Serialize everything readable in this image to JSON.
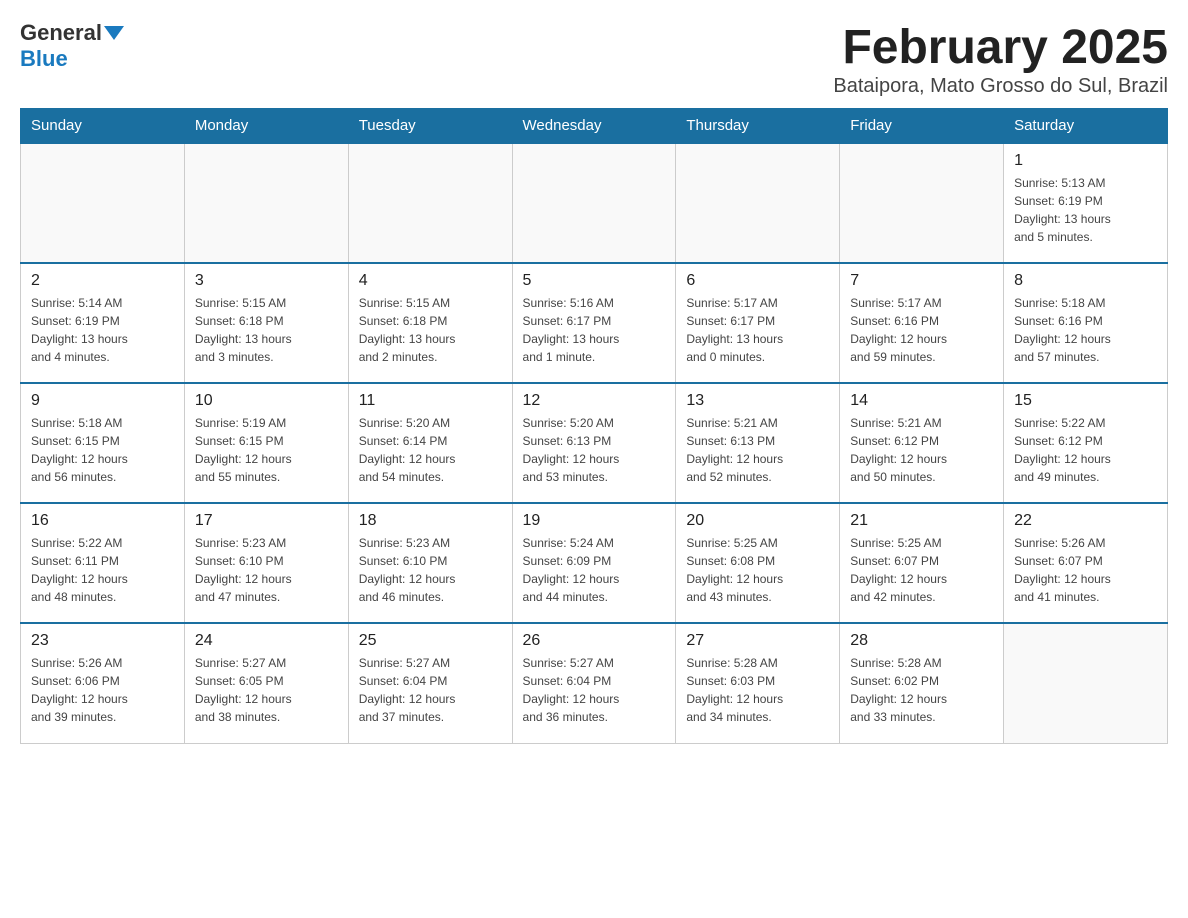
{
  "header": {
    "logo_general": "General",
    "logo_blue": "Blue",
    "month_title": "February 2025",
    "location": "Bataipora, Mato Grosso do Sul, Brazil"
  },
  "days_of_week": [
    "Sunday",
    "Monday",
    "Tuesday",
    "Wednesday",
    "Thursday",
    "Friday",
    "Saturday"
  ],
  "weeks": [
    {
      "days": [
        {
          "number": "",
          "info": ""
        },
        {
          "number": "",
          "info": ""
        },
        {
          "number": "",
          "info": ""
        },
        {
          "number": "",
          "info": ""
        },
        {
          "number": "",
          "info": ""
        },
        {
          "number": "",
          "info": ""
        },
        {
          "number": "1",
          "info": "Sunrise: 5:13 AM\nSunset: 6:19 PM\nDaylight: 13 hours\nand 5 minutes."
        }
      ]
    },
    {
      "days": [
        {
          "number": "2",
          "info": "Sunrise: 5:14 AM\nSunset: 6:19 PM\nDaylight: 13 hours\nand 4 minutes."
        },
        {
          "number": "3",
          "info": "Sunrise: 5:15 AM\nSunset: 6:18 PM\nDaylight: 13 hours\nand 3 minutes."
        },
        {
          "number": "4",
          "info": "Sunrise: 5:15 AM\nSunset: 6:18 PM\nDaylight: 13 hours\nand 2 minutes."
        },
        {
          "number": "5",
          "info": "Sunrise: 5:16 AM\nSunset: 6:17 PM\nDaylight: 13 hours\nand 1 minute."
        },
        {
          "number": "6",
          "info": "Sunrise: 5:17 AM\nSunset: 6:17 PM\nDaylight: 13 hours\nand 0 minutes."
        },
        {
          "number": "7",
          "info": "Sunrise: 5:17 AM\nSunset: 6:16 PM\nDaylight: 12 hours\nand 59 minutes."
        },
        {
          "number": "8",
          "info": "Sunrise: 5:18 AM\nSunset: 6:16 PM\nDaylight: 12 hours\nand 57 minutes."
        }
      ]
    },
    {
      "days": [
        {
          "number": "9",
          "info": "Sunrise: 5:18 AM\nSunset: 6:15 PM\nDaylight: 12 hours\nand 56 minutes."
        },
        {
          "number": "10",
          "info": "Sunrise: 5:19 AM\nSunset: 6:15 PM\nDaylight: 12 hours\nand 55 minutes."
        },
        {
          "number": "11",
          "info": "Sunrise: 5:20 AM\nSunset: 6:14 PM\nDaylight: 12 hours\nand 54 minutes."
        },
        {
          "number": "12",
          "info": "Sunrise: 5:20 AM\nSunset: 6:13 PM\nDaylight: 12 hours\nand 53 minutes."
        },
        {
          "number": "13",
          "info": "Sunrise: 5:21 AM\nSunset: 6:13 PM\nDaylight: 12 hours\nand 52 minutes."
        },
        {
          "number": "14",
          "info": "Sunrise: 5:21 AM\nSunset: 6:12 PM\nDaylight: 12 hours\nand 50 minutes."
        },
        {
          "number": "15",
          "info": "Sunrise: 5:22 AM\nSunset: 6:12 PM\nDaylight: 12 hours\nand 49 minutes."
        }
      ]
    },
    {
      "days": [
        {
          "number": "16",
          "info": "Sunrise: 5:22 AM\nSunset: 6:11 PM\nDaylight: 12 hours\nand 48 minutes."
        },
        {
          "number": "17",
          "info": "Sunrise: 5:23 AM\nSunset: 6:10 PM\nDaylight: 12 hours\nand 47 minutes."
        },
        {
          "number": "18",
          "info": "Sunrise: 5:23 AM\nSunset: 6:10 PM\nDaylight: 12 hours\nand 46 minutes."
        },
        {
          "number": "19",
          "info": "Sunrise: 5:24 AM\nSunset: 6:09 PM\nDaylight: 12 hours\nand 44 minutes."
        },
        {
          "number": "20",
          "info": "Sunrise: 5:25 AM\nSunset: 6:08 PM\nDaylight: 12 hours\nand 43 minutes."
        },
        {
          "number": "21",
          "info": "Sunrise: 5:25 AM\nSunset: 6:07 PM\nDaylight: 12 hours\nand 42 minutes."
        },
        {
          "number": "22",
          "info": "Sunrise: 5:26 AM\nSunset: 6:07 PM\nDaylight: 12 hours\nand 41 minutes."
        }
      ]
    },
    {
      "days": [
        {
          "number": "23",
          "info": "Sunrise: 5:26 AM\nSunset: 6:06 PM\nDaylight: 12 hours\nand 39 minutes."
        },
        {
          "number": "24",
          "info": "Sunrise: 5:27 AM\nSunset: 6:05 PM\nDaylight: 12 hours\nand 38 minutes."
        },
        {
          "number": "25",
          "info": "Sunrise: 5:27 AM\nSunset: 6:04 PM\nDaylight: 12 hours\nand 37 minutes."
        },
        {
          "number": "26",
          "info": "Sunrise: 5:27 AM\nSunset: 6:04 PM\nDaylight: 12 hours\nand 36 minutes."
        },
        {
          "number": "27",
          "info": "Sunrise: 5:28 AM\nSunset: 6:03 PM\nDaylight: 12 hours\nand 34 minutes."
        },
        {
          "number": "28",
          "info": "Sunrise: 5:28 AM\nSunset: 6:02 PM\nDaylight: 12 hours\nand 33 minutes."
        },
        {
          "number": "",
          "info": ""
        }
      ]
    }
  ]
}
